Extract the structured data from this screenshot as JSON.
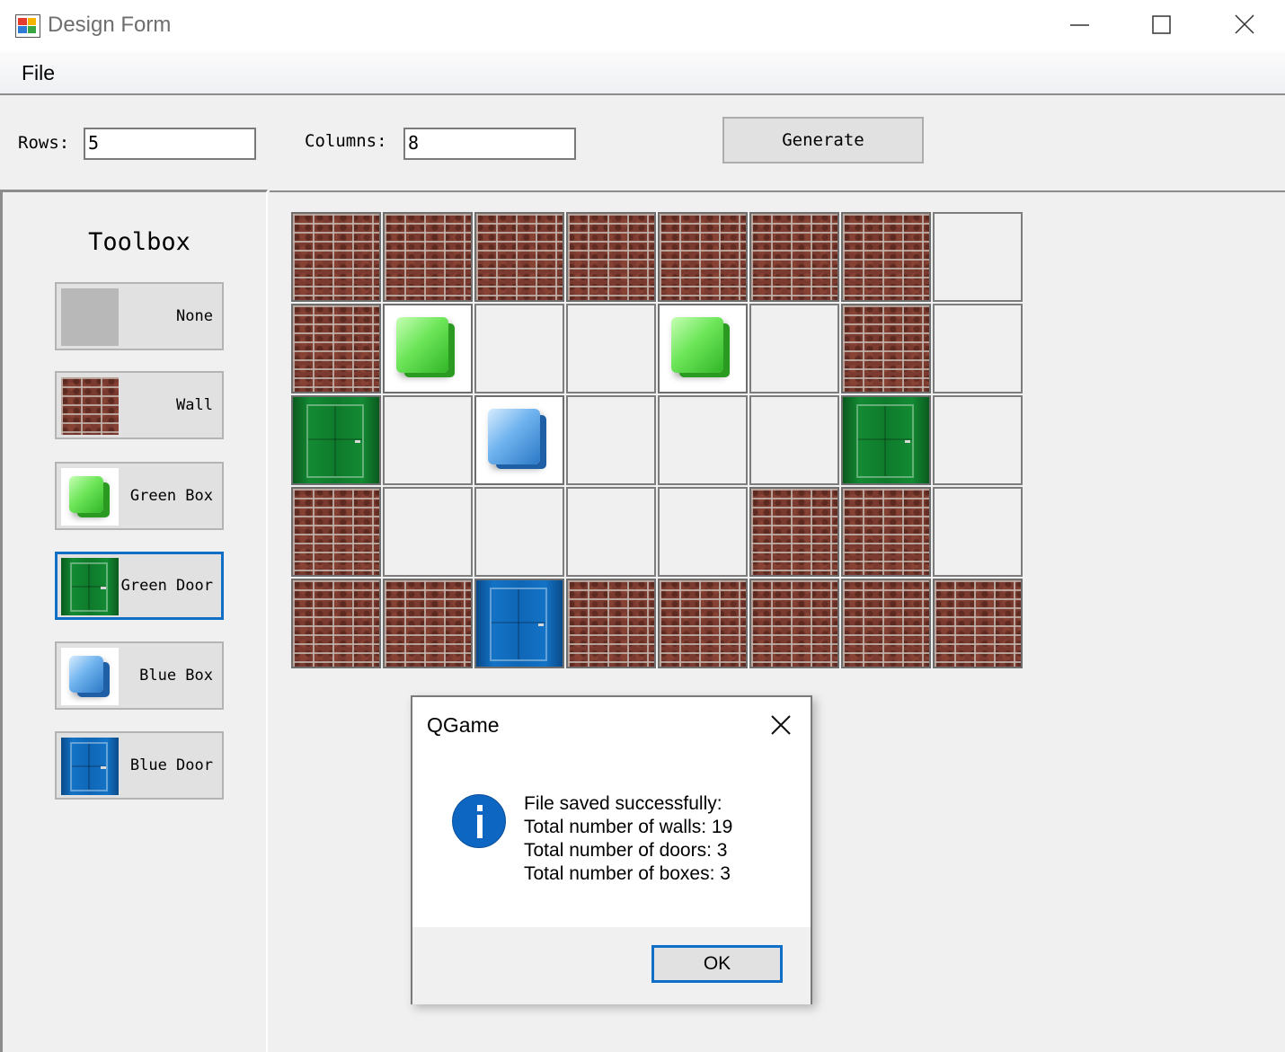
{
  "window": {
    "title": "Design Form"
  },
  "menu": {
    "file_label": "File"
  },
  "top_panel": {
    "rows_label": "Rows:",
    "rows_value": "5",
    "columns_label": "Columns:",
    "columns_value": "8",
    "generate_label": "Generate"
  },
  "toolbox": {
    "title": "Toolbox",
    "items": [
      {
        "label": "None",
        "tile": "none",
        "selected": false
      },
      {
        "label": "Wall",
        "tile": "wall",
        "selected": false
      },
      {
        "label": "Green Box",
        "tile": "green-box",
        "selected": false
      },
      {
        "label": "Green Door",
        "tile": "green-door",
        "selected": true
      },
      {
        "label": "Blue Box",
        "tile": "blue-box",
        "selected": false
      },
      {
        "label": "Blue Door",
        "tile": "blue-door",
        "selected": false
      }
    ]
  },
  "grid": {
    "cells": [
      [
        "wall",
        "wall",
        "wall",
        "wall",
        "wall",
        "wall",
        "wall",
        "empty"
      ],
      [
        "wall",
        "green-box",
        "empty",
        "empty",
        "green-box",
        "empty",
        "wall",
        "empty"
      ],
      [
        "green-door",
        "empty",
        "blue-box",
        "empty",
        "empty",
        "empty",
        "green-door",
        "empty"
      ],
      [
        "wall",
        "empty",
        "empty",
        "empty",
        "empty",
        "wall",
        "wall",
        "empty"
      ],
      [
        "wall",
        "wall",
        "blue-door",
        "wall",
        "wall",
        "wall",
        "wall",
        "wall"
      ]
    ]
  },
  "dialog": {
    "title": "QGame",
    "icon": "info-icon",
    "lines": [
      "File saved successfully:",
      "Total number of walls: 19",
      "Total number of doors: 3",
      "Total number of boxes: 3"
    ],
    "ok_label": "OK"
  },
  "colors": {
    "accent": "#0f6fc6",
    "info_icon": "#0d66c2",
    "window_bg": "#f0f0f0"
  }
}
